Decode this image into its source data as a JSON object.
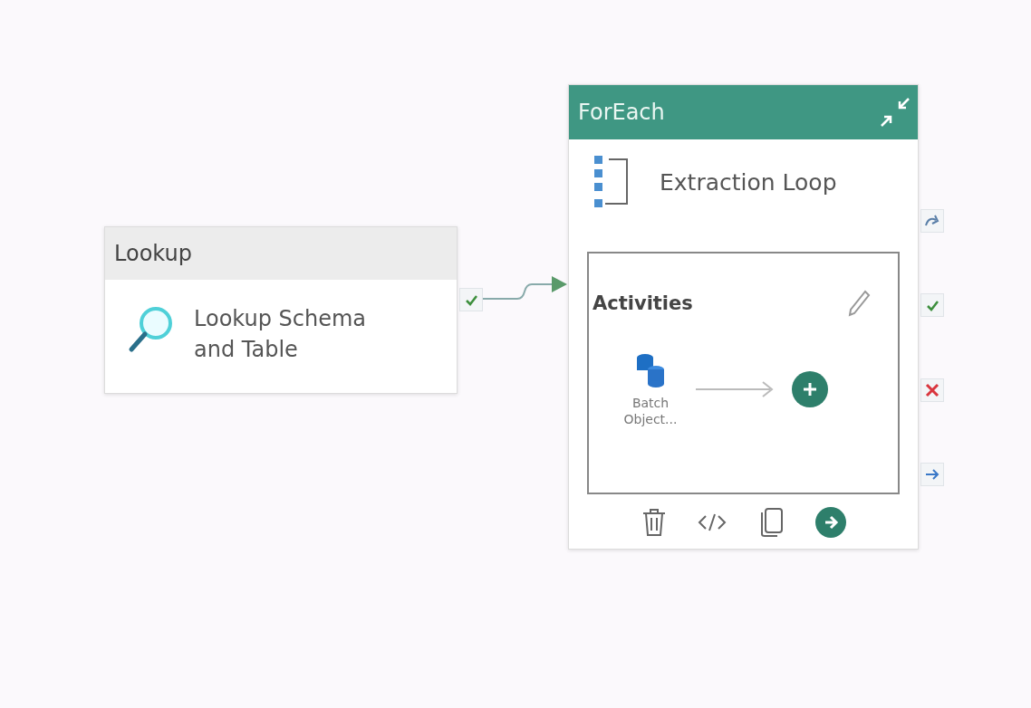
{
  "canvas": {
    "nodes": [
      {
        "kind": "activity",
        "type": "Lookup",
        "name": "Lookup Schema and Table"
      },
      {
        "kind": "container",
        "type": "ForEach",
        "name": "Extraction Loop",
        "expanded": true,
        "inner": {
          "title": "Activities",
          "activities": [
            {
              "name": "Batch Object..."
            }
          ]
        }
      }
    ]
  }
}
